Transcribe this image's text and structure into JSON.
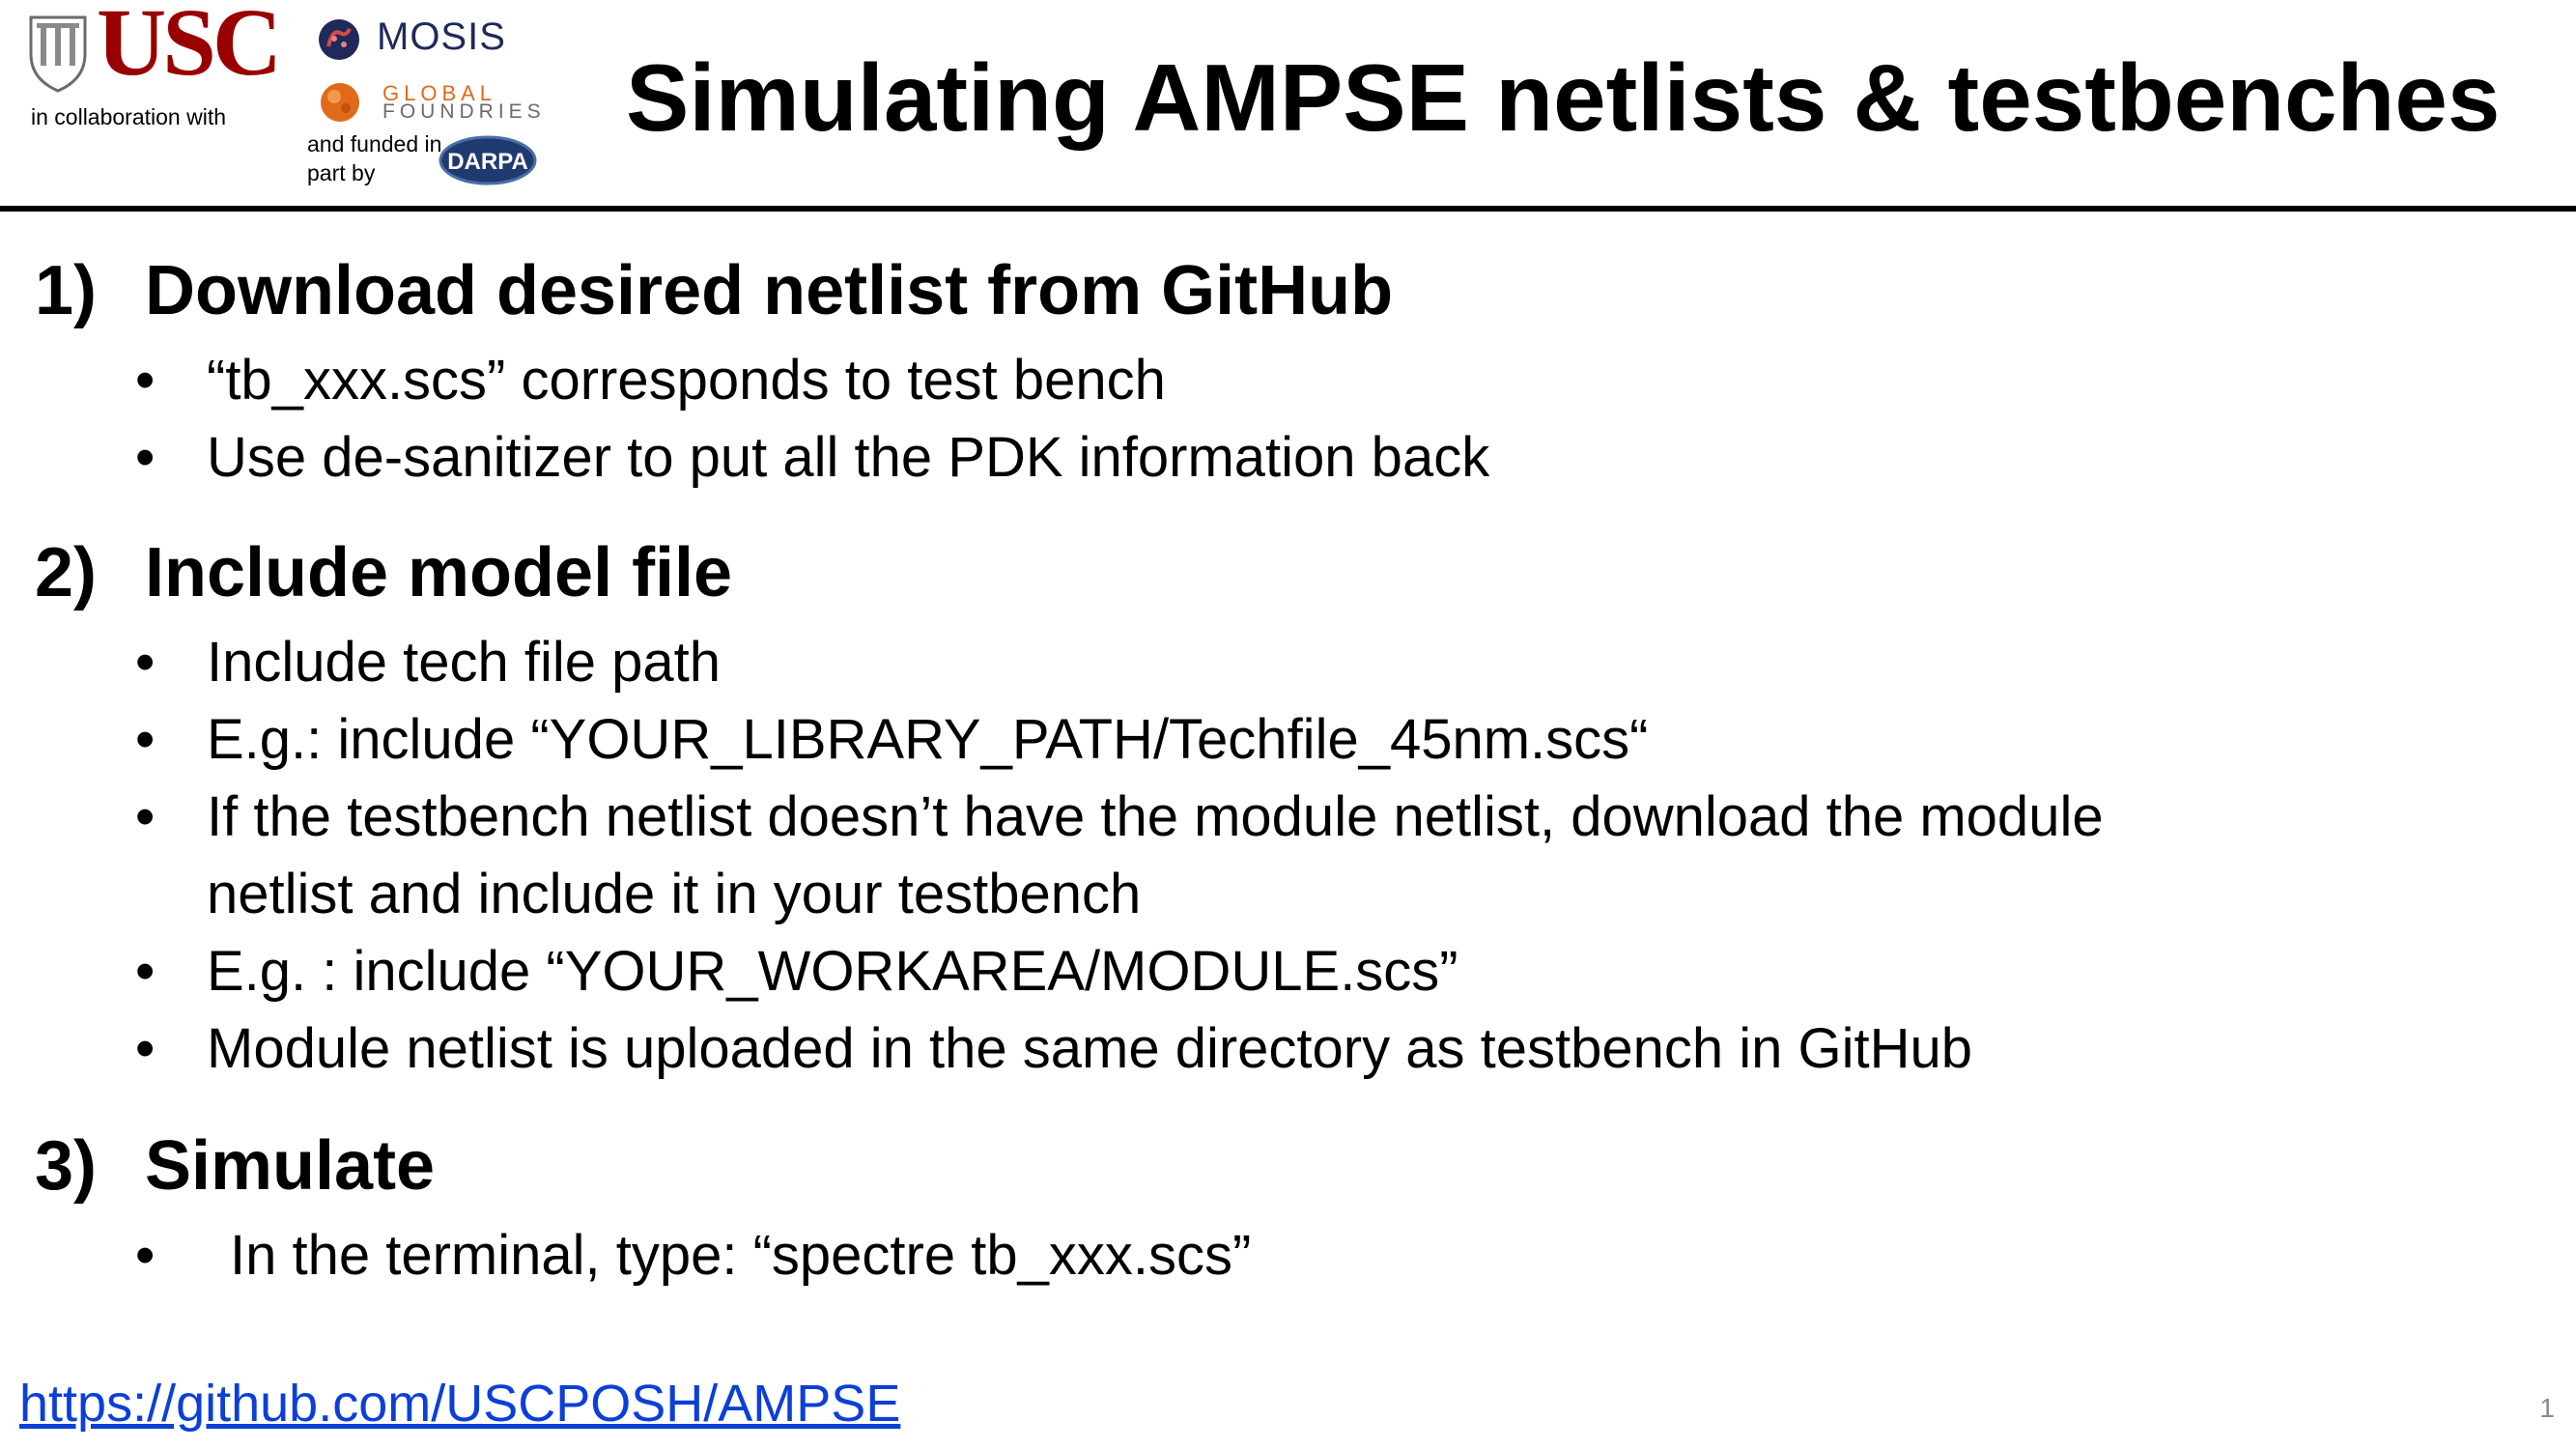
{
  "header": {
    "logo_usc": "USC",
    "collab_text": "in collaboration with",
    "logo_mosis": "MOSIS",
    "logo_gf_line1": "GLOBAL",
    "logo_gf_line2": "FOUNDRIES",
    "funded_text": "and funded in part by",
    "logo_darpa": "DARPA",
    "title": "Simulating AMPSE netlists & testbenches"
  },
  "sections": [
    {
      "number": "1)",
      "heading": "Download desired netlist from GitHub",
      "bullets": [
        "“tb_xxx.scs” corresponds to test bench",
        "Use de-sanitizer to put all the PDK information back"
      ]
    },
    {
      "number": "2)",
      "heading": "Include model file",
      "bullets": [
        "Include tech file path",
        "E.g.: include “YOUR_LIBRARY_PATH/Techfile_45nm.scs“",
        "If the testbench netlist doesn’t have the module netlist, download the module",
        "netlist and include it in your testbench",
        "E.g. : include “YOUR_WORKAREA/MODULE.scs”",
        "Module netlist is uploaded in the same directory as testbench in GitHub"
      ]
    },
    {
      "number": "3)",
      "heading": "Simulate",
      "bullets": [
        "In the terminal, type: “spectre tb_xxx.scs”"
      ]
    }
  ],
  "bullet_glyph": "•",
  "footer": {
    "link": "https://github.com/USCPOSH/AMPSE",
    "page_number": "1"
  },
  "colors": {
    "usc_red": "#990000",
    "link_blue": "#0b3fd8",
    "gf_orange": "#e06a1a"
  }
}
